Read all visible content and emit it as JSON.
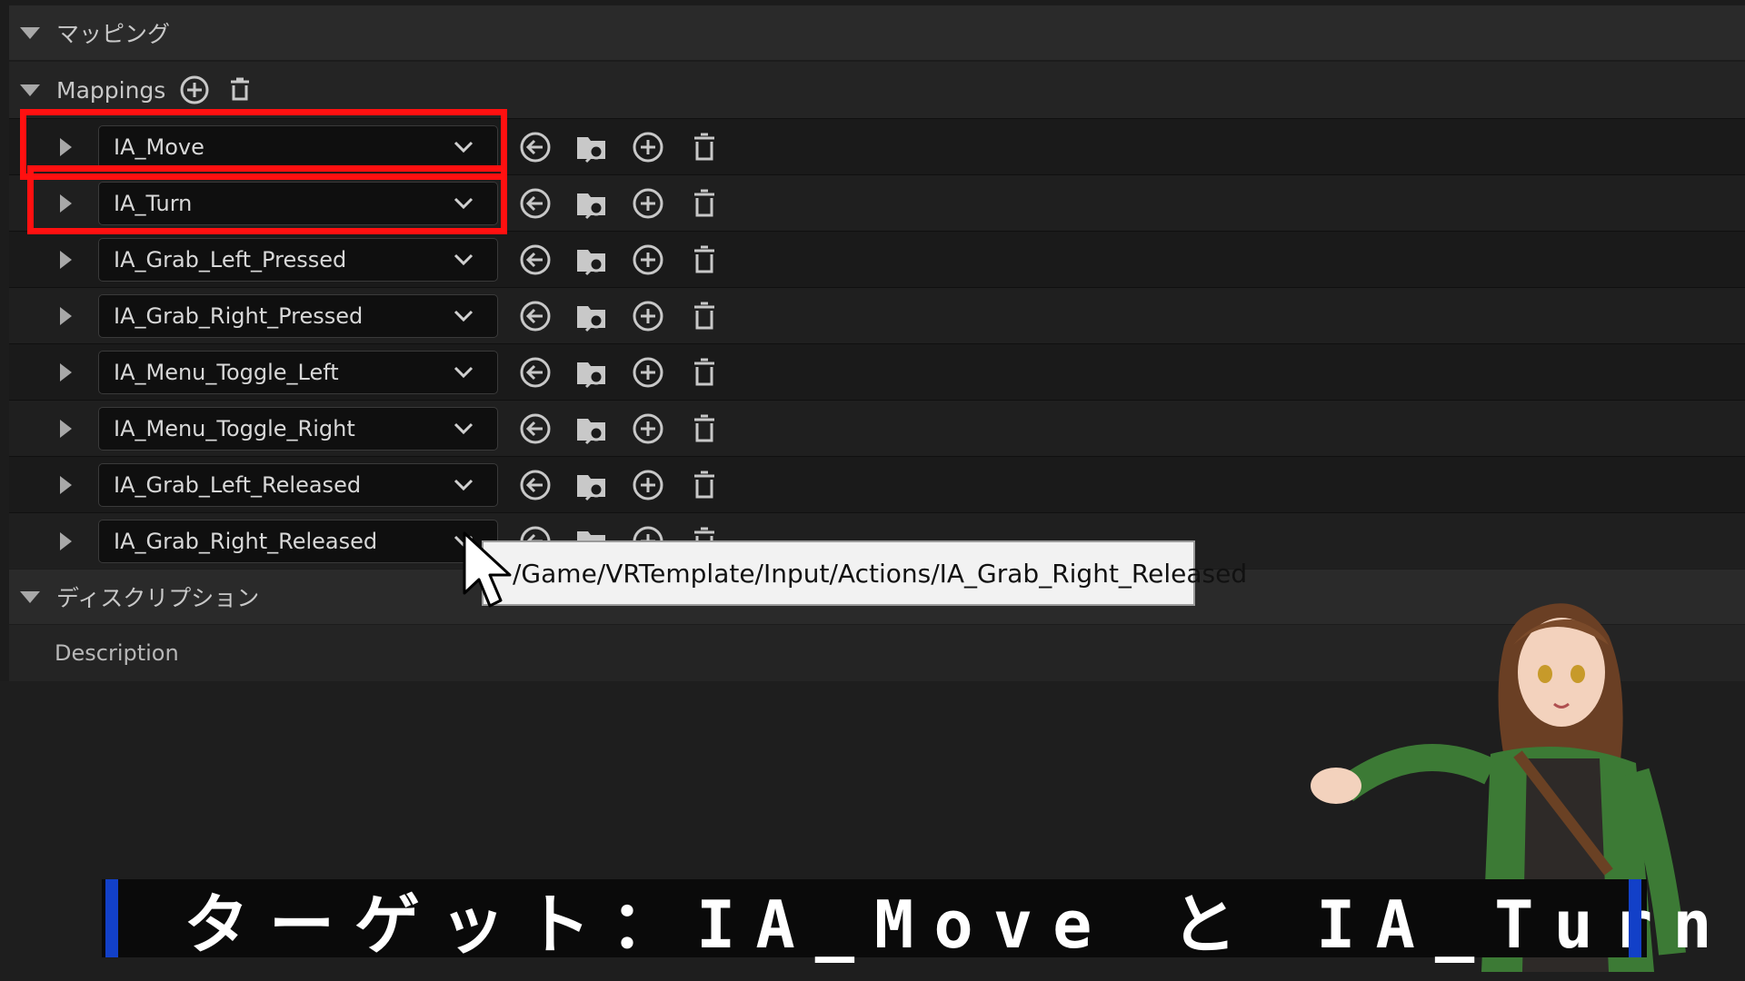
{
  "sections": {
    "mapping_title": "マッピング",
    "mappings_label": "Mappings",
    "description_title": "ディスクリプション",
    "description_label": "Description"
  },
  "mappings": [
    {
      "value": "IA_Move",
      "highlighted": true
    },
    {
      "value": "IA_Turn",
      "highlighted": true
    },
    {
      "value": "IA_Grab_Left_Pressed",
      "highlighted": false
    },
    {
      "value": "IA_Grab_Right_Pressed",
      "highlighted": false
    },
    {
      "value": "IA_Menu_Toggle_Left",
      "highlighted": false
    },
    {
      "value": "IA_Menu_Toggle_Right",
      "highlighted": false
    },
    {
      "value": "IA_Grab_Left_Released",
      "highlighted": false
    },
    {
      "value": "IA_Grab_Right_Released",
      "highlighted": false
    }
  ],
  "row_icons": [
    "return-arrow-icon",
    "browse-folder-icon",
    "add-circle-icon",
    "trash-icon"
  ],
  "tooltip": "/Game/VRTemplate/Input/Actions/IA_Grab_Right_Released",
  "caption": "ターゲット：IA_Move と IA_Turn",
  "colors": {
    "highlight": "#ff1010",
    "caption_accent": "#1240c8",
    "background": "#1c1c1c"
  }
}
